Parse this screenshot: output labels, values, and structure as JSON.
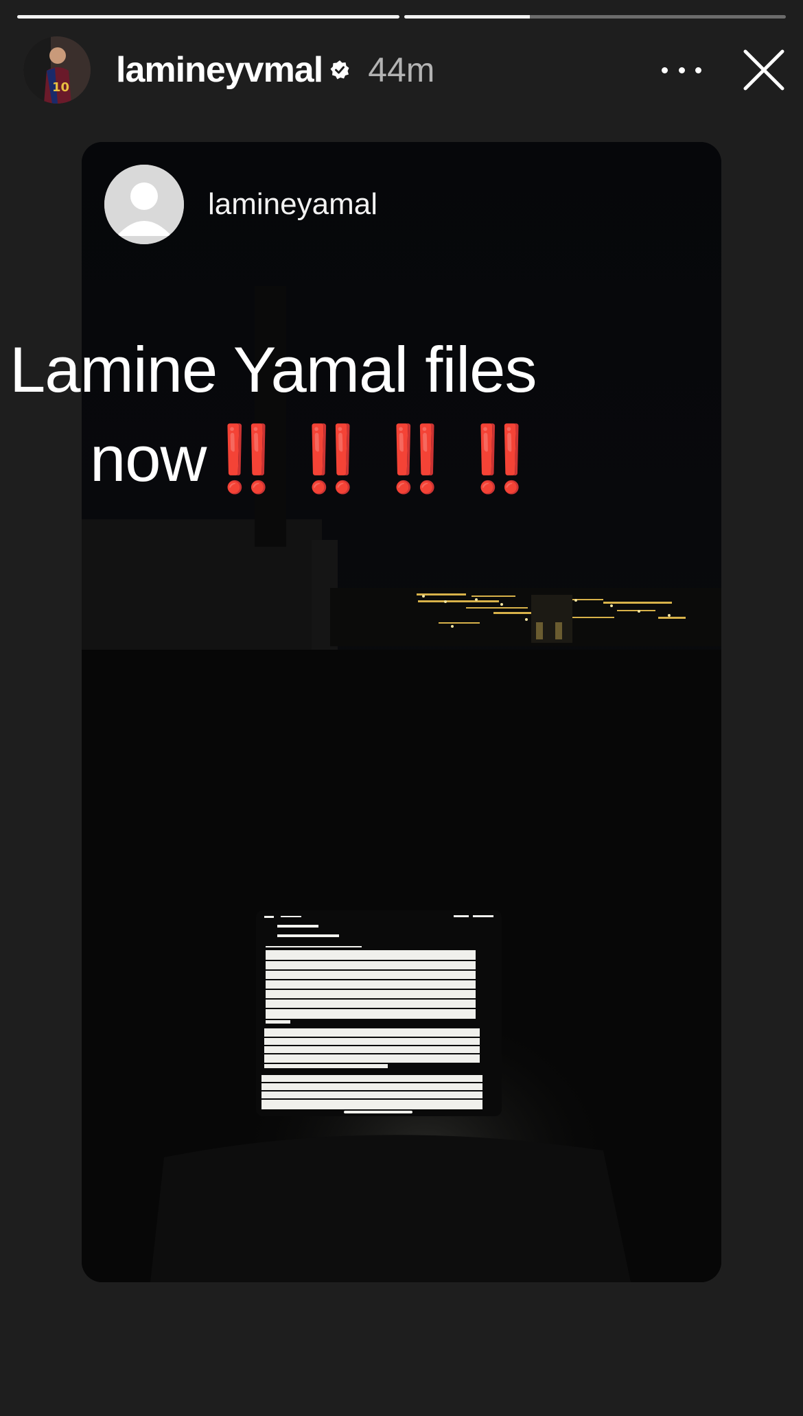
{
  "story": {
    "progress": [
      1.0,
      0.33
    ],
    "username": "lamineyvmal",
    "verified": true,
    "timestamp": "44m",
    "icons": {
      "verified": "verified-badge-icon",
      "more": "more-options-icon",
      "close": "close-icon"
    }
  },
  "repost": {
    "username": "lamineyamal",
    "avatar_icon": "default-avatar-icon"
  },
  "overlay": {
    "line1": "Lamine Yamal files",
    "line2_text": "now",
    "line2_emoji": "‼️‼️‼️‼️"
  },
  "colors": {
    "background": "#1e1e1e",
    "accent_red": "#e0150c"
  }
}
